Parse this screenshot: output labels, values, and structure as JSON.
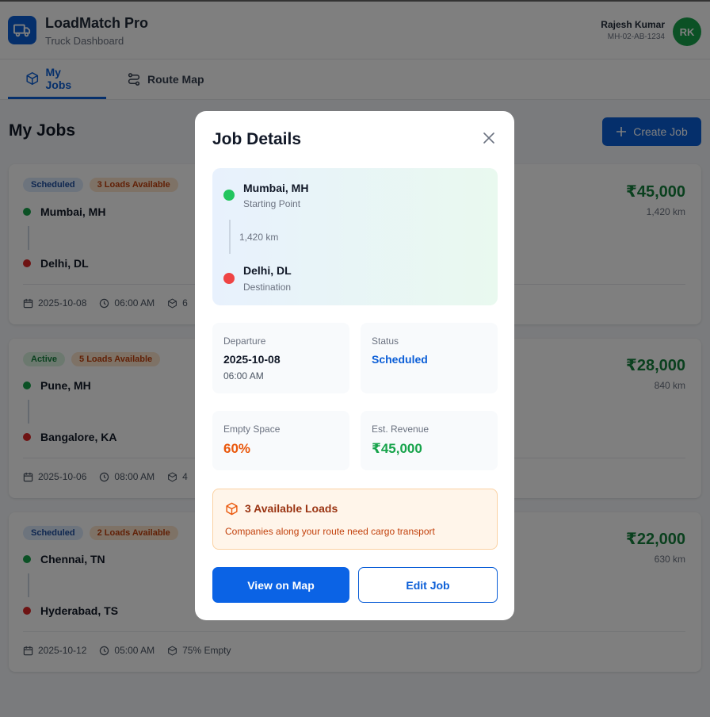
{
  "app": {
    "title": "LoadMatch Pro",
    "subtitle": "Truck Dashboard"
  },
  "user": {
    "name": "Rajesh Kumar",
    "vehicle": "MH-02-AB-1234",
    "initials": "RK"
  },
  "tabs": [
    {
      "label": "My Jobs",
      "active": true,
      "icon": "box-icon"
    },
    {
      "label": "Route Map",
      "active": false,
      "icon": "route-icon"
    }
  ],
  "page": {
    "title": "My Jobs",
    "create_label": "Create Job"
  },
  "jobs": [
    {
      "status": "Scheduled",
      "loads": "3 Loads Available",
      "from": "Mumbai, MH",
      "to": "Delhi, DL",
      "price": "₹45,000",
      "distance": "1,420 km",
      "date": "2025-10-08",
      "time": "06:00 AM",
      "empty": "6"
    },
    {
      "status": "Active",
      "loads": "5 Loads Available",
      "from": "Pune, MH",
      "to": "Bangalore, KA",
      "price": "₹28,000",
      "distance": "840 km",
      "date": "2025-10-06",
      "time": "08:00 AM",
      "empty": "4"
    },
    {
      "status": "Scheduled",
      "loads": "2 Loads Available",
      "from": "Chennai, TN",
      "to": "Hyderabad, TS",
      "price": "₹22,000",
      "distance": "630 km",
      "date": "2025-10-12",
      "time": "05:00 AM",
      "empty": "75% Empty"
    }
  ],
  "modal": {
    "title": "Job Details",
    "origin": {
      "city": "Mumbai, MH",
      "label": "Starting Point"
    },
    "distance": "1,420 km",
    "destination": {
      "city": "Delhi, DL",
      "label": "Destination"
    },
    "departure": {
      "label": "Departure",
      "date": "2025-10-08",
      "time": "06:00 AM"
    },
    "status": {
      "label": "Status",
      "value": "Scheduled"
    },
    "empty_space": {
      "label": "Empty Space",
      "value": "60%"
    },
    "revenue": {
      "label": "Est. Revenue",
      "value": "₹45,000"
    },
    "loads": {
      "title": "3 Available Loads",
      "desc": "Companies along your route need cargo transport"
    },
    "view_map_label": "View on Map",
    "edit_label": "Edit Job"
  },
  "colors": {
    "primary": "#0b5ed7",
    "success": "#16a34a",
    "danger": "#dc2626",
    "warning": "#c2410c"
  }
}
